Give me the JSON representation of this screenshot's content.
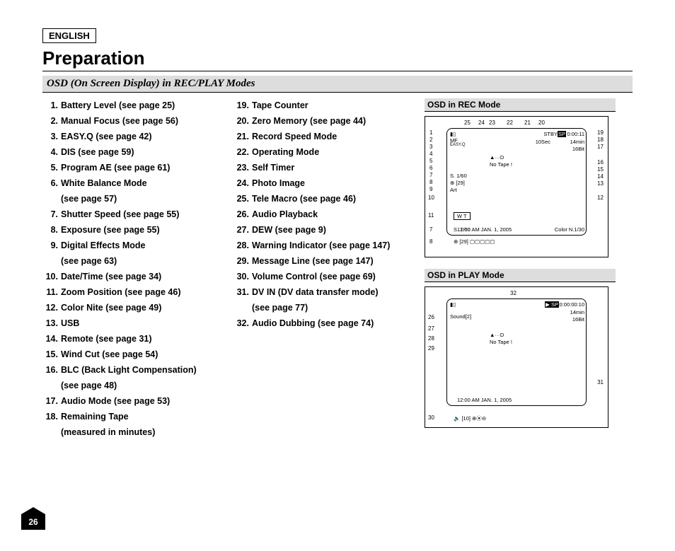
{
  "language_label": "ENGLISH",
  "title": "Preparation",
  "subtitle": "OSD (On Screen Display) in REC/PLAY Modes",
  "page_number": "26",
  "list_col1": [
    {
      "n": "1.",
      "t": "Battery Level (see page 25)"
    },
    {
      "n": "2.",
      "t": "Manual Focus (see page 56)"
    },
    {
      "n": "3.",
      "t": "EASY.Q (see page 42)"
    },
    {
      "n": "4.",
      "t": "DIS (see page 59)"
    },
    {
      "n": "5.",
      "t": "Program AE (see page 61)"
    },
    {
      "n": "6.",
      "t": "White Balance Mode"
    },
    {
      "n": "",
      "t": "(see page 57)"
    },
    {
      "n": "7.",
      "t": "Shutter Speed (see page 55)"
    },
    {
      "n": "8.",
      "t": "Exposure (see page 55)"
    },
    {
      "n": "9.",
      "t": "Digital Effects Mode"
    },
    {
      "n": "",
      "t": "(see page 63)"
    },
    {
      "n": "10.",
      "t": "Date/Time (see page 34)"
    },
    {
      "n": "11.",
      "t": "Zoom Position (see page 46)"
    },
    {
      "n": "12.",
      "t": "Color Nite (see page 49)"
    },
    {
      "n": "13.",
      "t": "USB"
    },
    {
      "n": "14.",
      "t": "Remote (see page 31)"
    },
    {
      "n": "15.",
      "t": "Wind Cut (see page 54)"
    },
    {
      "n": "16.",
      "t": "BLC (Back Light Compensation)"
    },
    {
      "n": "",
      "t": "(see page 48)"
    },
    {
      "n": "17.",
      "t": "Audio Mode (see page 53)"
    },
    {
      "n": "18.",
      "t": "Remaining Tape"
    },
    {
      "n": "",
      "t": "(measured in minutes)"
    }
  ],
  "list_col2": [
    {
      "n": "19.",
      "t": "Tape Counter"
    },
    {
      "n": "20.",
      "t": "Zero Memory (see page 44)"
    },
    {
      "n": "21.",
      "t": "Record Speed Mode"
    },
    {
      "n": "22.",
      "t": "Operating Mode"
    },
    {
      "n": "23.",
      "t": "Self Timer"
    },
    {
      "n": "24.",
      "t": "Photo Image"
    },
    {
      "n": "25.",
      "t": "Tele Macro (see page 46)"
    },
    {
      "n": "26.",
      "t": "Audio Playback"
    },
    {
      "n": "27.",
      "t": "DEW (see page 9)"
    },
    {
      "n": "28.",
      "t": "Warning Indicator (see page 147)"
    },
    {
      "n": "29.",
      "t": "Message Line (see page 147)"
    },
    {
      "n": "30.",
      "t": "Volume Control (see page 69)"
    },
    {
      "n": "31.",
      "t": "DV IN (DV data transfer mode)"
    },
    {
      "n": "",
      "t": "(see page 77)"
    },
    {
      "n": "32.",
      "t": "Audio Dubbing (see page 74)"
    }
  ],
  "rec_mode_heading": "OSD in REC Mode",
  "play_mode_heading": "OSD in PLAY Mode",
  "rec_osd": {
    "top_nums": [
      "25",
      "24",
      "23",
      "22",
      "21",
      "20"
    ],
    "left_nums": [
      "1",
      "2",
      "3",
      "4",
      "5",
      "6",
      "7",
      "8",
      "9",
      "10"
    ],
    "right_nums": [
      "19",
      "18",
      "17",
      "16",
      "15",
      "14",
      "13",
      "12"
    ],
    "below_left": [
      "11",
      "7",
      "8"
    ],
    "inner": {
      "stby": "STBY",
      "sp": "SP",
      "timer": "10Sec",
      "tc": "0:00:11",
      "remain": "14min",
      "audio": "16Bit",
      "no_tape": "No Tape !",
      "shutter": "S. 1/60",
      "exposure": "[29]",
      "art": "Art",
      "datetime": "12:00 AM JAN. 1, 2005",
      "colornite": "Color N.1/30",
      "mf": "MF",
      "easyq": "EASY.Q",
      "wt": "W          T",
      "dew": "▲···D"
    }
  },
  "play_osd": {
    "top_num": "32",
    "left_nums": [
      "26",
      "27",
      "28",
      "29"
    ],
    "right_num": "31",
    "bottom_num": "30",
    "inner": {
      "sp": "SP",
      "tc": "0:00:00:10",
      "remain": "14min",
      "audio": "16Bit",
      "sound": "Sound[2]",
      "no_tape": "No Tape !",
      "datetime": "12:00 AM JAN. 1, 2005",
      "vol": "[10]",
      "dew": "▲···D"
    }
  }
}
